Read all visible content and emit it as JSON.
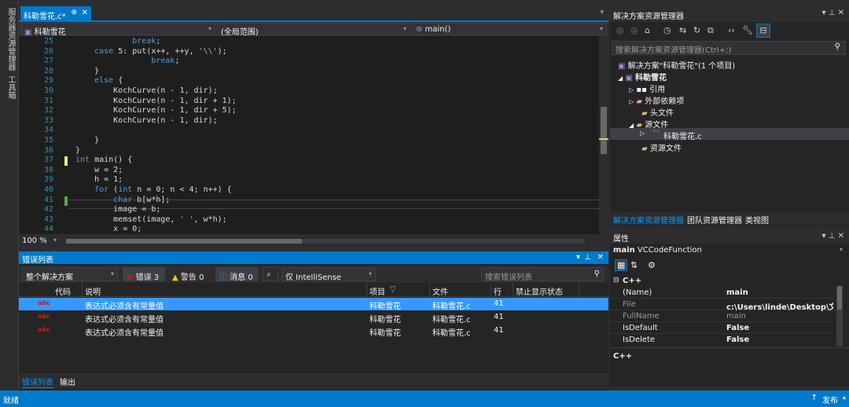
{
  "left_strip": {
    "tab1": "服务器资源管理器",
    "tab2": "工具箱"
  },
  "editor": {
    "tab_title": "科勒雪花.c*",
    "tab_pin": "⊕",
    "tab_close": "✕",
    "nav_project": "科勒雪花",
    "nav_scope": "(全局范围)",
    "nav_func": "main()",
    "zoom": "100 %",
    "lines": [
      {
        "n": "25",
        "code": "            break;"
      },
      {
        "n": "26",
        "code": "    case 5: put(x++, ++y, '\\\\');"
      },
      {
        "n": "27",
        "code": "                break;"
      },
      {
        "n": "28",
        "code": "    }"
      },
      {
        "n": "29",
        "code": "    else {"
      },
      {
        "n": "30",
        "code": "        KochCurve(n - 1, dir);"
      },
      {
        "n": "31",
        "code": "        KochCurve(n - 1, dir + 1);"
      },
      {
        "n": "32",
        "code": "        KochCurve(n - 1, dir + 5);"
      },
      {
        "n": "33",
        "code": "        KochCurve(n - 1, dir);"
      },
      {
        "n": "34",
        "code": ""
      },
      {
        "n": "35",
        "code": "    }"
      },
      {
        "n": "36",
        "code": "}"
      },
      {
        "n": "37",
        "code": "int main() {"
      },
      {
        "n": "38",
        "code": "    w = 2;"
      },
      {
        "n": "39",
        "code": "    h = 1;"
      },
      {
        "n": "40",
        "code": "    for (int n = 0; n < 4; n++) {"
      },
      {
        "n": "41",
        "code": "        char b[w*h];"
      },
      {
        "n": "42",
        "code": "        image = b;"
      },
      {
        "n": "43",
        "code": "        memset(image, ' ', w*h);"
      },
      {
        "n": "44",
        "code": "        x = 0;"
      }
    ]
  },
  "error_list": {
    "title": "错误列表",
    "scope": "整个解决方案",
    "errors_btn": "错误 3",
    "warnings_btn": "警告 0",
    "messages_btn": "消息 0",
    "filter": "仅 IntelliSense",
    "search_placeholder": "搜索错误列表",
    "headers": {
      "code": "代码",
      "desc": "说明",
      "project": "项目",
      "file": "文件",
      "line": "行",
      "suppress": "禁止显示状态"
    },
    "rows": [
      {
        "desc": "表达式必须含有常量值",
        "project": "科勒雪花",
        "file": "科勒雪花.c",
        "line": "41"
      },
      {
        "desc": "表达式必须含有常量值",
        "project": "科勒雪花",
        "file": "科勒雪花.c",
        "line": "41"
      },
      {
        "desc": "表达式必须含有常量值",
        "project": "科勒雪花",
        "file": "科勒雪花.c",
        "line": "41"
      }
    ],
    "tab_errors": "错误列表",
    "tab_output": "输出"
  },
  "solution_explorer": {
    "title": "解决方案资源管理器",
    "search_placeholder": "搜索解决方案资源管理器(Ctrl+;)",
    "solution": "解决方案\"科勒雪花\"(1 个项目)",
    "project": "科勒雪花",
    "refs": "引用",
    "ext_deps": "外部依赖项",
    "headers": "头文件",
    "sources": "源文件",
    "source_file": "科勒雪花.c",
    "resources": "资源文件",
    "tab1": "解决方案资源管理器",
    "tab2": "团队资源管理器",
    "tab3": "类视图"
  },
  "properties": {
    "title": "属性",
    "object_name": "main",
    "object_type": "VCCodeFunction",
    "category": "C++",
    "rows": [
      {
        "name": "(Name)",
        "value": "main"
      },
      {
        "name": "File",
        "value": "c:\\Users\\linde\\Desktop\\文件"
      },
      {
        "name": "FullName",
        "value": "main"
      },
      {
        "name": "IsDefault",
        "value": "False"
      },
      {
        "name": "IsDelete",
        "value": "False"
      }
    ],
    "desc": "C++"
  },
  "status": {
    "left": "就绪",
    "right": "发布"
  },
  "colors": {
    "accent": "#007acc",
    "selection": "#3399ff",
    "error": "#e51400"
  }
}
